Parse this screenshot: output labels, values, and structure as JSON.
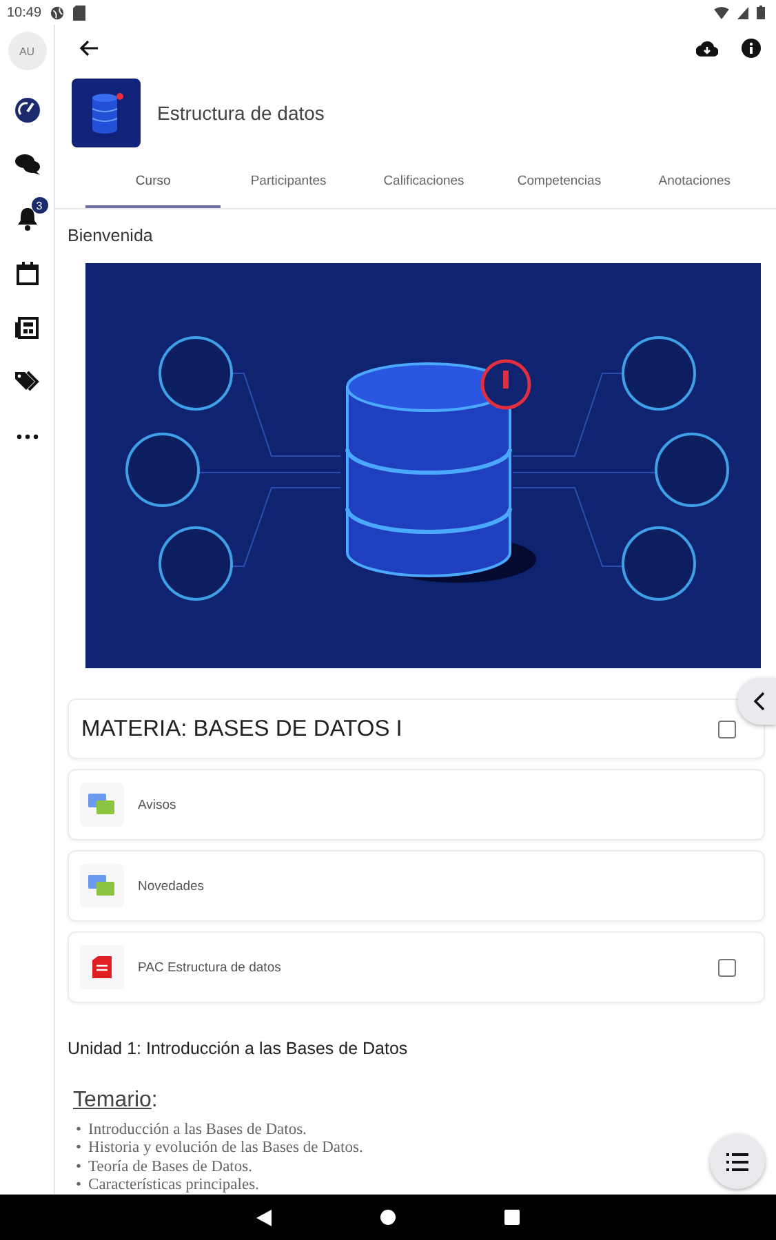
{
  "status_bar": {
    "time": "10:49"
  },
  "sidebar": {
    "avatar": "AU",
    "items": [
      {
        "kind": "dashboard"
      },
      {
        "kind": "messages"
      },
      {
        "kind": "notifications",
        "badge": "3"
      },
      {
        "kind": "calendar"
      },
      {
        "kind": "news"
      },
      {
        "kind": "tags"
      },
      {
        "kind": "more"
      }
    ]
  },
  "course": {
    "title": "Estructura de datos"
  },
  "tabs": [
    {
      "label": "Curso",
      "selected": true
    },
    {
      "label": "Participantes",
      "selected": false
    },
    {
      "label": "Calificaciones",
      "selected": false
    },
    {
      "label": "Competencias",
      "selected": false
    },
    {
      "label": "Anotaciones",
      "selected": false
    }
  ],
  "section_title": "Bienvenida",
  "cards": [
    {
      "kind": "section",
      "title": "MATERIA: BASES DE DATOS I",
      "checked": false
    },
    {
      "kind": "forum",
      "title": "Avisos"
    },
    {
      "kind": "forum",
      "title": "Novedades"
    },
    {
      "kind": "file",
      "title": "PAC Estructura de datos",
      "checked": false
    }
  ],
  "unit_title": "Unidad 1: Introducción a las Bases de Datos",
  "syllabus": {
    "heading": "Temario",
    "suffix": ":",
    "marker": "•",
    "items": [
      "Introducción a las Bases de Datos.",
      "Historia y evolución de las Bases de Datos.",
      "Teoría de Bases de Datos.",
      "Características principales."
    ]
  }
}
